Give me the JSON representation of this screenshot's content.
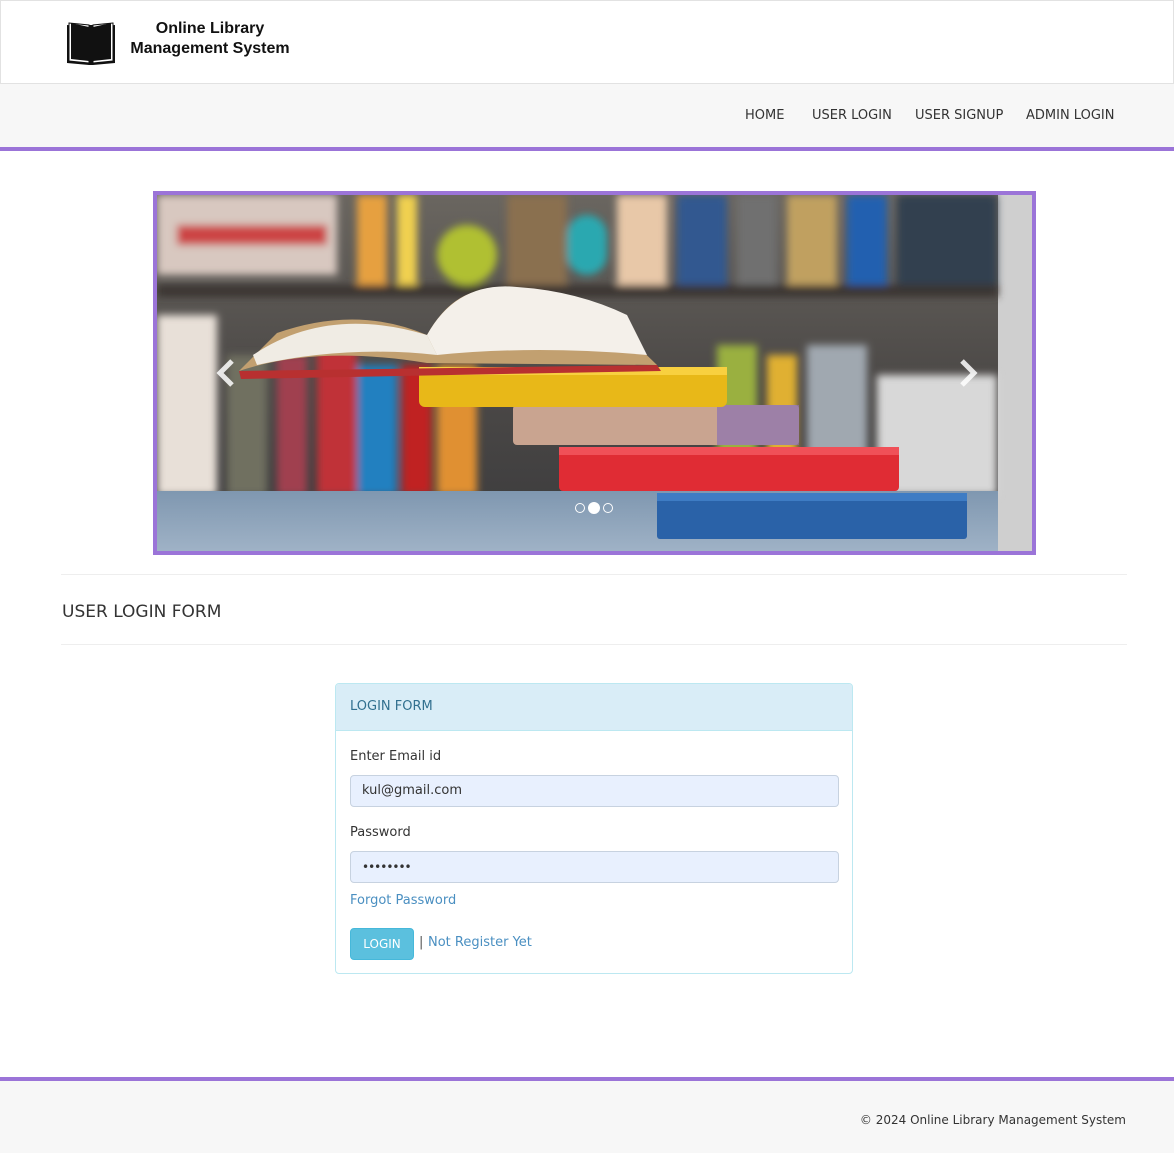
{
  "brand": {
    "line1": "Online Library",
    "line2": "Management System",
    "logo_icon": "open-book-icon"
  },
  "nav": {
    "items": [
      {
        "label": "HOME"
      },
      {
        "label": "USER LOGIN"
      },
      {
        "label": "USER SIGNUP"
      },
      {
        "label": "ADMIN LOGIN"
      }
    ]
  },
  "carousel": {
    "slide_count": 3,
    "active_index": 1,
    "prev_icon": "chevron-left-icon",
    "next_icon": "chevron-right-icon"
  },
  "section": {
    "title": "USER LOGIN FORM"
  },
  "login_panel": {
    "heading": "LOGIN FORM",
    "email_label": "Enter Email id",
    "email_value": "kul@gmail.com",
    "password_label": "Password",
    "password_value": "••••••••",
    "forgot_link": "Forgot Password",
    "login_button": "LOGIN",
    "separator": "|",
    "register_link": "Not Register Yet"
  },
  "footer": {
    "copyright": "© 2024 Online Library Management System"
  },
  "colors": {
    "accent": "#9b74d8",
    "panel_heading_bg": "#d9edf7",
    "login_button": "#5bc0de",
    "link": "#4a8fc1"
  }
}
